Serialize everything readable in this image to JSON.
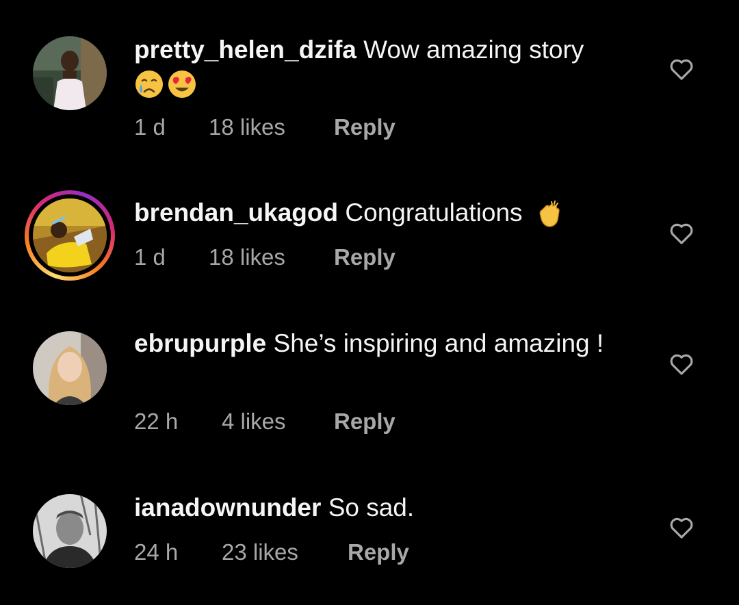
{
  "colors": {
    "background": "#000000",
    "text_primary": "#f5f5f5",
    "text_secondary": "#a8a8a8"
  },
  "comments": [
    {
      "username": "pretty_helen_dzifa",
      "text": "Wow amazing story",
      "emoji": [
        "crying-face-icon",
        "heart-eyes-face-icon"
      ],
      "time": "1 d",
      "likes": "18 likes",
      "reply_label": "Reply",
      "has_story_ring": false
    },
    {
      "username": "brendan_ukagod",
      "text": "Congratulations",
      "emoji": [
        "clapping-hands-icon"
      ],
      "time": "1 d",
      "likes": "18 likes",
      "reply_label": "Reply",
      "has_story_ring": true
    },
    {
      "username": "ebrupurple",
      "text": "She’s inspiring and amazing !",
      "emoji": [],
      "time": "22 h",
      "likes": "4 likes",
      "reply_label": "Reply",
      "has_story_ring": false
    },
    {
      "username": "ianadownunder",
      "text": "So sad.",
      "emoji": [],
      "time": "24 h",
      "likes": "23 likes",
      "reply_label": "Reply",
      "has_story_ring": false
    }
  ]
}
